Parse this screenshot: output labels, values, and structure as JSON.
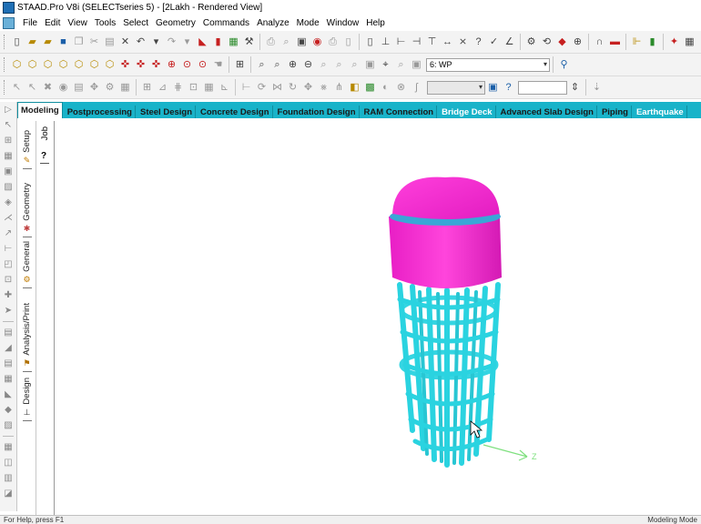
{
  "window": {
    "title": "STAAD.Pro V8i (SELECTseries 5) - [2Lakh - Rendered View]"
  },
  "menu": [
    "File",
    "Edit",
    "View",
    "Tools",
    "Select",
    "Geometry",
    "Commands",
    "Analyze",
    "Mode",
    "Window",
    "Help"
  ],
  "toolbar2": {
    "workplane_select": "6: WP"
  },
  "tabs": [
    "Modeling",
    "Postprocessing",
    "Steel Design",
    "Concrete Design",
    "Foundation Design",
    "RAM Connection",
    "Bridge Deck",
    "Advanced Slab Design",
    "Piping",
    "Earthquake"
  ],
  "active_tab": "Modeling",
  "side_tabs": [
    "Setup",
    "Geometry",
    "General",
    "Analysis/Print",
    "Design"
  ],
  "job_panel": {
    "label": "Job",
    "icon_text": "?"
  },
  "model": {
    "tank_color": "#ff2fd2",
    "frame_color": "#2ad3e0",
    "ring_color": "#3aa6d6",
    "axis_label": "Z",
    "axis_color": "#7fe07f"
  },
  "status": {
    "left": "For Help, press F1",
    "right": "Modeling Mode"
  }
}
